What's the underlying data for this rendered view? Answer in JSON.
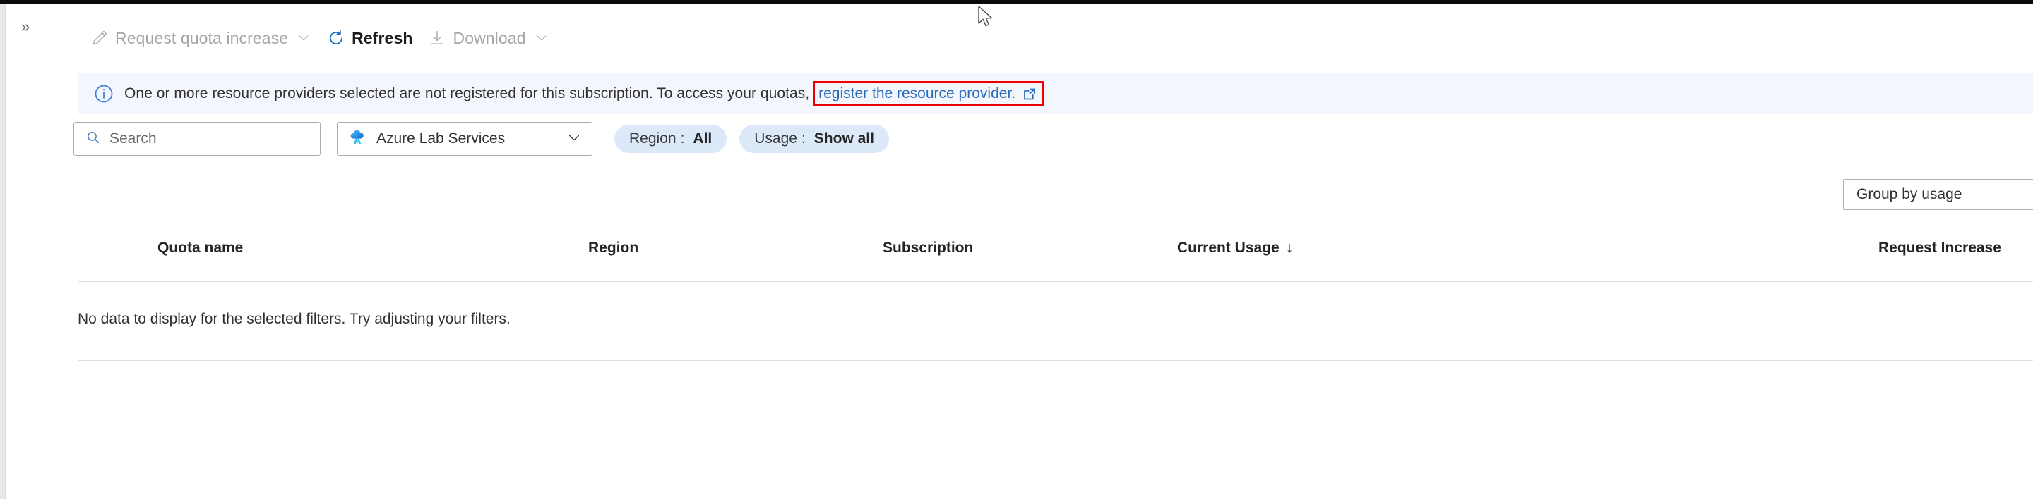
{
  "window": {
    "expand_chevron": "»"
  },
  "toolbar": {
    "items": [
      {
        "label": "Request quota increase",
        "icon": "pencil-icon",
        "has_caret": true,
        "enabled": false
      },
      {
        "label": "Refresh",
        "icon": "refresh-icon",
        "has_caret": false,
        "enabled": true
      },
      {
        "label": "Download",
        "icon": "download-icon",
        "has_caret": true,
        "enabled": false
      }
    ]
  },
  "banner": {
    "icon": "info-icon",
    "message": "One or more resource providers selected are not registered for this subscription. To access your quotas,",
    "link_text": "register the resource provider.",
    "link_icon": "external-link-icon",
    "highlight_color": "#ee0000",
    "background": "#f3f7fd"
  },
  "filters": {
    "search": {
      "placeholder": "Search",
      "value": "",
      "icon": "search-icon"
    },
    "service": {
      "label": "Azure Lab Services",
      "icon": "azure-lab-services-icon",
      "caret": "chevron-down-icon"
    },
    "pills": [
      {
        "key": "Region",
        "separator": ":",
        "value": "All"
      },
      {
        "key": "Usage",
        "separator": ":",
        "value": "Show all"
      }
    ]
  },
  "group_by": {
    "label": "Group by usage"
  },
  "table": {
    "columns": [
      {
        "label": "Quota name",
        "sorted": false
      },
      {
        "label": "Region",
        "sorted": false
      },
      {
        "label": "Subscription",
        "sorted": false
      },
      {
        "label": "Current Usage",
        "sorted": true,
        "sort_arrow": "↓"
      },
      {
        "label": "Request Increase",
        "sorted": false
      }
    ],
    "empty_message": "No data to display for the selected filters. Try adjusting your filters."
  }
}
